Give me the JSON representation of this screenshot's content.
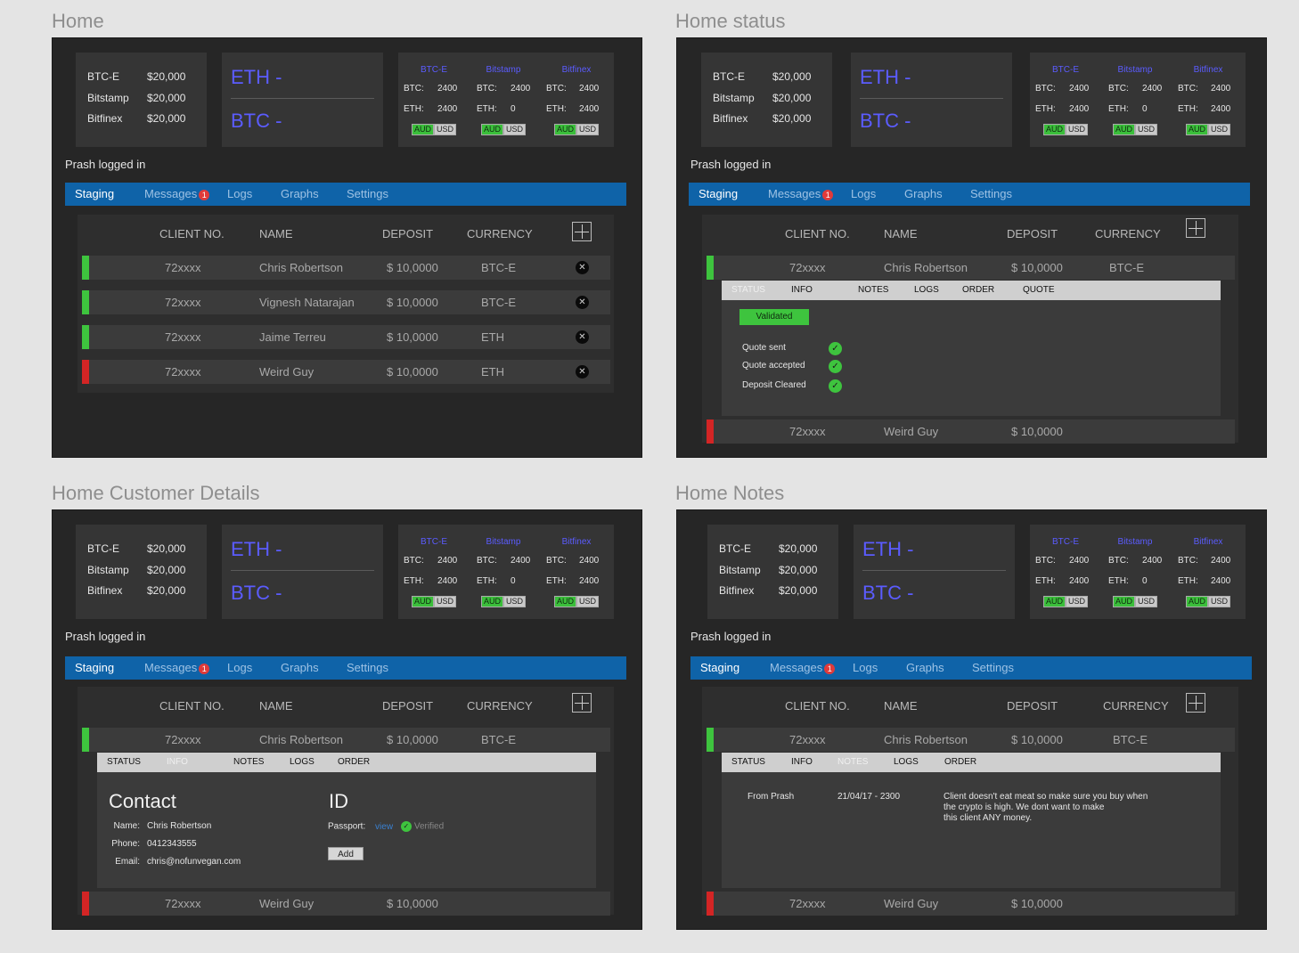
{
  "frames": {
    "home": {
      "title": "Home"
    },
    "status": {
      "title": "Home status"
    },
    "customer": {
      "title": "Home Customer Details"
    },
    "notes": {
      "title": "Home Notes"
    }
  },
  "balances": [
    {
      "name": "BTC-E",
      "amount": "$20,000"
    },
    {
      "name": "Bitstamp",
      "amount": "$20,000"
    },
    {
      "name": "Bitfinex",
      "amount": "$20,000"
    }
  ],
  "prices": {
    "eth": "ETH -",
    "btc": "BTC -"
  },
  "exchanges": [
    {
      "name": "BTC-E",
      "btc_label": "BTC:",
      "btc": "2400",
      "eth_label": "ETH:",
      "eth": "2400",
      "aud": "AUD",
      "usd": "USD"
    },
    {
      "name": "Bitstamp",
      "btc_label": "BTC:",
      "btc": "2400",
      "eth_label": "ETH:",
      "eth": "0",
      "aud": "AUD",
      "usd": "USD"
    },
    {
      "name": "Bitfinex",
      "btc_label": "BTC:",
      "btc": "2400",
      "eth_label": "ETH:",
      "eth": "2400",
      "aud": "AUD",
      "usd": "USD"
    }
  ],
  "logged_in": "Prash logged in",
  "tabs": {
    "staging": "Staging",
    "messages": "Messages",
    "messages_badge": "1",
    "logs": "Logs",
    "graphs": "Graphs",
    "settings": "Settings"
  },
  "columns": {
    "client_no": "CLIENT NO.",
    "name": "NAME",
    "deposit": "DEPOSIT",
    "currency": "CURRENCY"
  },
  "rows": [
    {
      "client": "72xxxx",
      "name": "Chris Robertson",
      "deposit": "$ 10,0000",
      "currency": "BTC-E",
      "status": "green"
    },
    {
      "client": "72xxxx",
      "name": "Vignesh Natarajan",
      "deposit": "$ 10,0000",
      "currency": "BTC-E",
      "status": "green"
    },
    {
      "client": "72xxxx",
      "name": "Jaime Terreu",
      "deposit": "$ 10,0000",
      "currency": "ETH",
      "status": "green"
    },
    {
      "client": "72xxxx",
      "name": "Weird Guy",
      "deposit": "$ 10,0000",
      "currency": "ETH",
      "status": "red"
    }
  ],
  "subtabs": {
    "status": "STATUS",
    "info": "INFO",
    "notes": "NOTES",
    "logs": "LOGS",
    "order": "ORDER",
    "quote": "QUOTE"
  },
  "status_panel": {
    "validated": "Validated",
    "checks": [
      "Quote sent",
      "Quote accepted",
      "Deposit Cleared"
    ]
  },
  "contact": {
    "heading": "Contact",
    "name_label": "Name:",
    "name": "Chris Robertson",
    "phone_label": "Phone:",
    "phone": "0412343555",
    "email_label": "Email:",
    "email": "chris@nofunvegan.com",
    "id_heading": "ID",
    "passport_label": "Passport:",
    "view": "view",
    "verified": "Verified",
    "add": "Add"
  },
  "note": {
    "author": "From Prash",
    "time": "21/04/17 - 2300",
    "lines": [
      "Client doesn't eat meat so make sure you buy when",
      "the crypto is high. We dont want to make",
      "this client ANY money."
    ]
  },
  "colors": {
    "accent": "#0f63a8",
    "ok": "#3ec43e",
    "alert": "#d32525",
    "link": "#5b5cff"
  }
}
